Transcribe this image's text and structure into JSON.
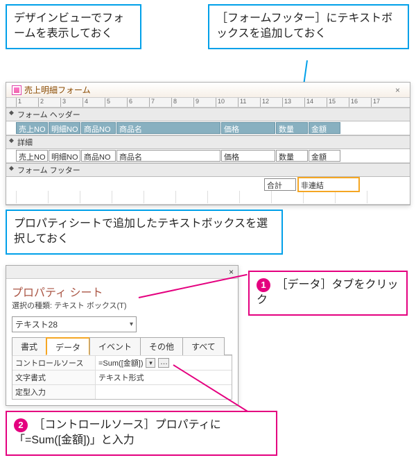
{
  "callouts": {
    "top_left": "デザインビューでフォームを表示しておく",
    "top_right": "［フォームフッター］にテキストボックスを追加しておく",
    "middle": "プロパティシートで追加したテキストボックスを選択しておく"
  },
  "steps": {
    "s1_num": "1",
    "s1_text": "［データ］タブをクリック",
    "s2_num": "2",
    "s2_text": "［コントロールソース］プロパティに「=Sum([金額])」と入力"
  },
  "form_design": {
    "tab_name": "売上明細フォーム",
    "ruler": [
      "1",
      "2",
      "3",
      "4",
      "5",
      "6",
      "7",
      "8",
      "9",
      "10",
      "11",
      "12",
      "13",
      "14",
      "15",
      "16",
      "17"
    ],
    "section_header": "フォーム ヘッダー",
    "section_detail": "詳細",
    "section_footer": "フォーム フッター",
    "header_fields": [
      "売上NO",
      "明細NO",
      "商品NO",
      "商品名",
      "価格",
      "数量",
      "金額"
    ],
    "detail_fields": [
      "売上NO",
      "明細NO",
      "商品NO",
      "商品名",
      "価格",
      "数量",
      "金額"
    ],
    "footer_label": "合計",
    "footer_box": "非連結"
  },
  "property_sheet": {
    "title": "プロパティ シート",
    "subtype": "選択の種類: テキスト ボックス(T)",
    "close_icon": "×",
    "combo_value": "テキスト28",
    "tabs": [
      "書式",
      "データ",
      "イベント",
      "その他",
      "すべて"
    ],
    "active_tab_index": 1,
    "rows": [
      {
        "k": "コントロールソース",
        "v": "=Sum([金額])",
        "dd": true,
        "dots": true
      },
      {
        "k": "文字書式",
        "v": "テキスト形式",
        "dd": false,
        "dots": false
      },
      {
        "k": "定型入力",
        "v": "",
        "dd": false,
        "dots": false
      }
    ]
  },
  "field_widths": {
    "header": [
      46,
      46,
      50,
      150,
      78,
      46,
      46
    ],
    "detail": [
      46,
      46,
      50,
      150,
      78,
      46,
      46
    ]
  }
}
